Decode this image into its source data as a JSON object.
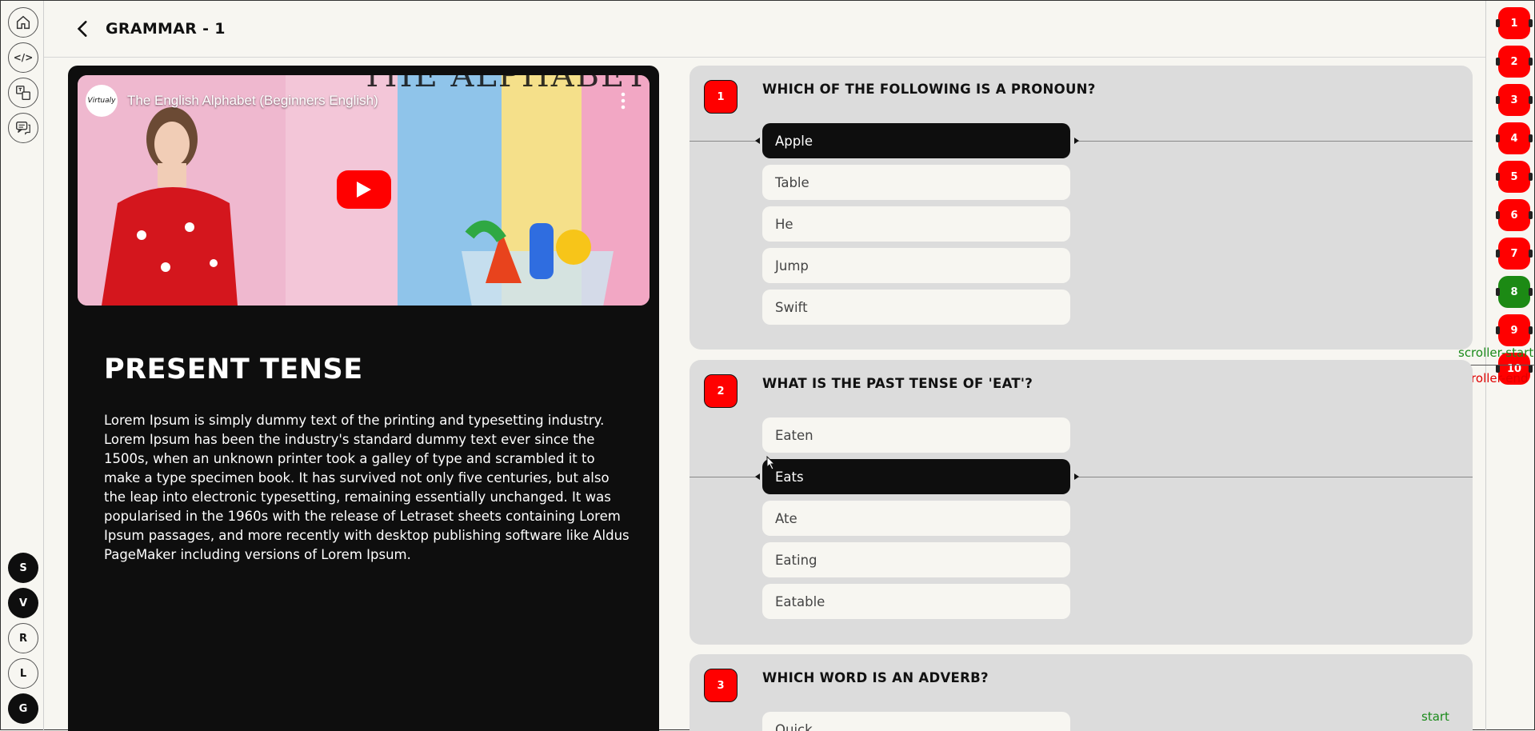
{
  "header": {
    "title": "GRAMMAR - 1"
  },
  "left_rail": {
    "tools": [
      {
        "name": "home-icon"
      },
      {
        "name": "code-icon"
      },
      {
        "name": "translate-icon"
      },
      {
        "name": "chat-icon"
      }
    ],
    "modes": [
      {
        "label": "S",
        "style": "dark"
      },
      {
        "label": "V",
        "style": "dark"
      },
      {
        "label": "R",
        "style": "light"
      },
      {
        "label": "L",
        "style": "light"
      },
      {
        "label": "G",
        "style": "dark"
      }
    ]
  },
  "right_rail": {
    "questions": [
      {
        "label": "1",
        "status": "red"
      },
      {
        "label": "2",
        "status": "red"
      },
      {
        "label": "3",
        "status": "red"
      },
      {
        "label": "4",
        "status": "red"
      },
      {
        "label": "5",
        "status": "red"
      },
      {
        "label": "6",
        "status": "red"
      },
      {
        "label": "7",
        "status": "red"
      },
      {
        "label": "8",
        "status": "green"
      },
      {
        "label": "9",
        "status": "red"
      },
      {
        "label": "10",
        "status": "red"
      }
    ],
    "scroller_start": "scroller-start",
    "scroller_end": "scroller-end"
  },
  "lesson": {
    "video": {
      "channel": "Virtualy",
      "title": "The English Alphabet (Beginners English)",
      "banner_text": "THE ALPHABET"
    },
    "title": "PRESENT TENSE",
    "body": "Lorem Ipsum is simply dummy text of the printing and typesetting industry. Lorem Ipsum has been the industry's standard dummy text ever since the 1500s, when an unknown printer took a galley of type and scrambled it to make a type specimen book. It has survived not only five centuries, but also the leap into electronic typesetting, remaining essentially unchanged. It was popularised in the 1960s with the release of Letraset sheets containing Lorem Ipsum passages, and more recently with desktop publishing software like Aldus PageMaker including versions of Lorem Ipsum."
  },
  "quiz": {
    "questions": [
      {
        "number": "1",
        "text": "WHICH OF THE FOLLOWING IS A PRONOUN?",
        "options": [
          "Apple",
          "Table",
          "He",
          "Jump",
          "Swift"
        ],
        "selected": 0
      },
      {
        "number": "2",
        "text": "WHAT IS THE PAST TENSE OF 'EAT'?",
        "options": [
          "Eaten",
          "Eats",
          "Ate",
          "Eating",
          "Eatable"
        ],
        "selected": 1
      },
      {
        "number": "3",
        "text": "WHICH WORD IS AN ADVERB?",
        "options": [
          "Quick"
        ],
        "selected": -1
      }
    ],
    "start_label": "start"
  },
  "colors": {
    "accent_red": "#ff0000",
    "accent_green": "#1c8a14",
    "dark": "#0e0e0e",
    "card": "#dcdcdc"
  }
}
